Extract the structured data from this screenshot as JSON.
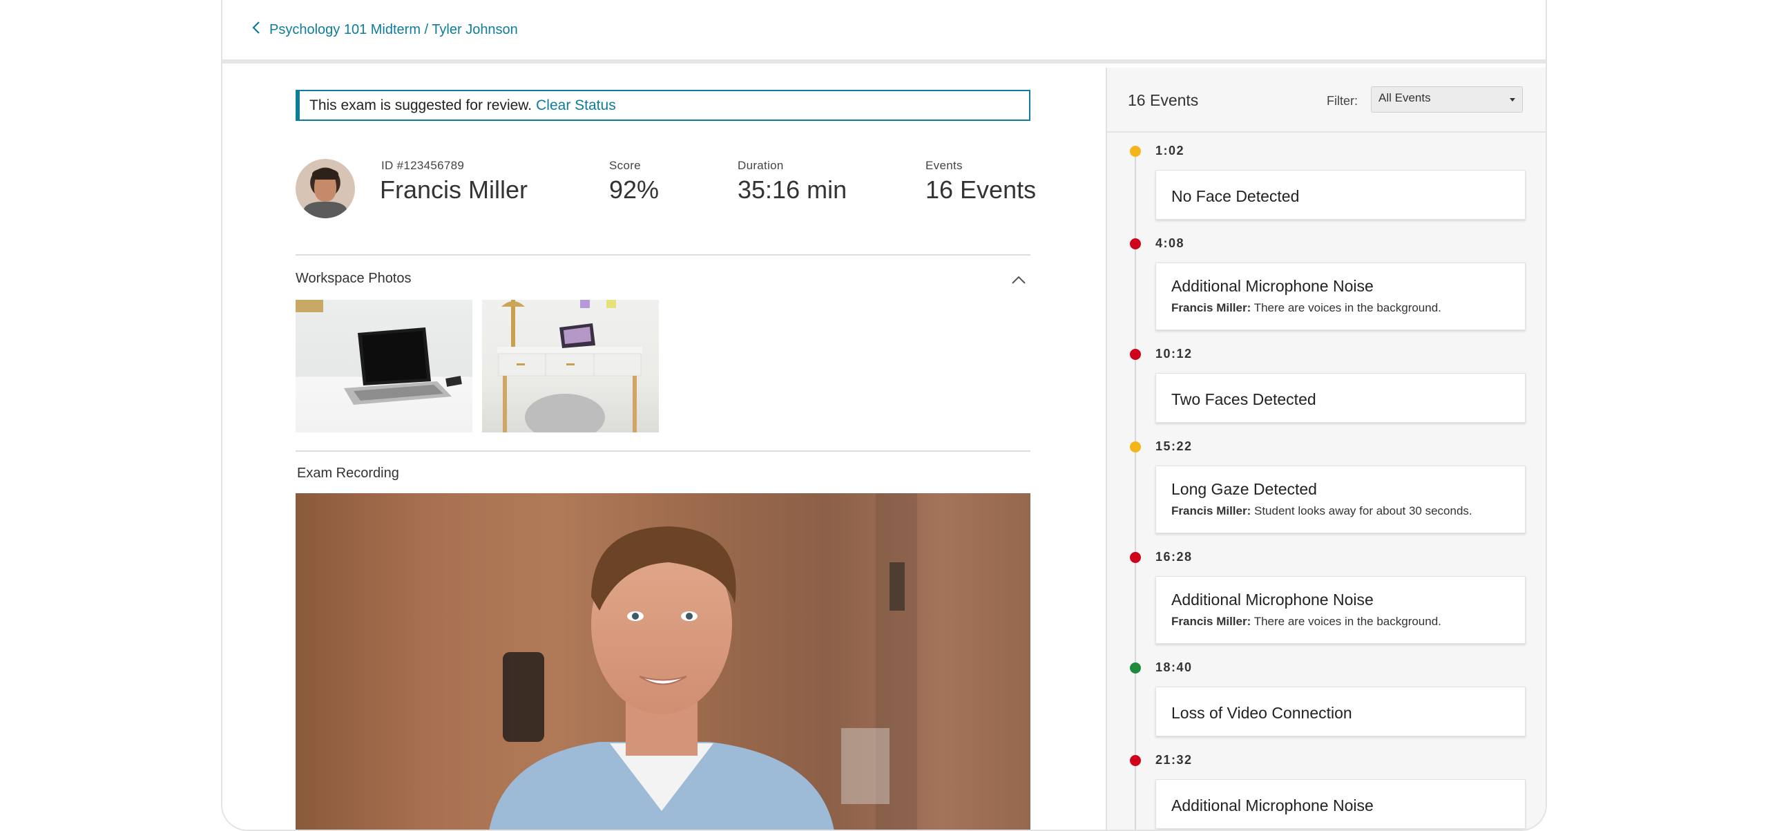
{
  "breadcrumb": {
    "label": "Psychology 101 Midterm / Tyler Johnson"
  },
  "banner": {
    "text": "This exam is suggested for review.",
    "link": "Clear Status"
  },
  "student": {
    "id_text": "ID #123456789",
    "name": "Francis Miller",
    "score_label": "Score",
    "score_value": "92%",
    "duration_label": "Duration",
    "duration_value": "35:16 min",
    "events_label": "Events",
    "events_value": "16 Events"
  },
  "sections": {
    "workspace_photos": "Workspace Photos",
    "exam_recording": "Exam Recording"
  },
  "events_panel": {
    "title": "16 Events",
    "filter_label": "Filter:",
    "filter_value": "All Events",
    "colors": {
      "warning": "#f4b41a",
      "alert": "#d0021b",
      "ok": "#1e8a3c"
    },
    "events": [
      {
        "time": "1:02",
        "level": "warning",
        "title": "No Face Detected",
        "author": "",
        "note": ""
      },
      {
        "time": "4:08",
        "level": "alert",
        "title": "Additional Microphone Noise",
        "author": "Francis Miller:",
        "note": "There are voices in the background."
      },
      {
        "time": "10:12",
        "level": "alert",
        "title": "Two Faces Detected",
        "author": "",
        "note": ""
      },
      {
        "time": "15:22",
        "level": "warning",
        "title": "Long Gaze Detected",
        "author": "Francis Miller:",
        "note": "Student looks away for about 30 seconds."
      },
      {
        "time": "16:28",
        "level": "alert",
        "title": "Additional Microphone Noise",
        "author": "Francis Miller:",
        "note": "There are voices in the background."
      },
      {
        "time": "18:40",
        "level": "ok",
        "title": "Loss of Video Connection",
        "author": "",
        "note": ""
      },
      {
        "time": "21:32",
        "level": "alert",
        "title": "Additional Microphone Noise",
        "author": "",
        "note": ""
      }
    ]
  }
}
